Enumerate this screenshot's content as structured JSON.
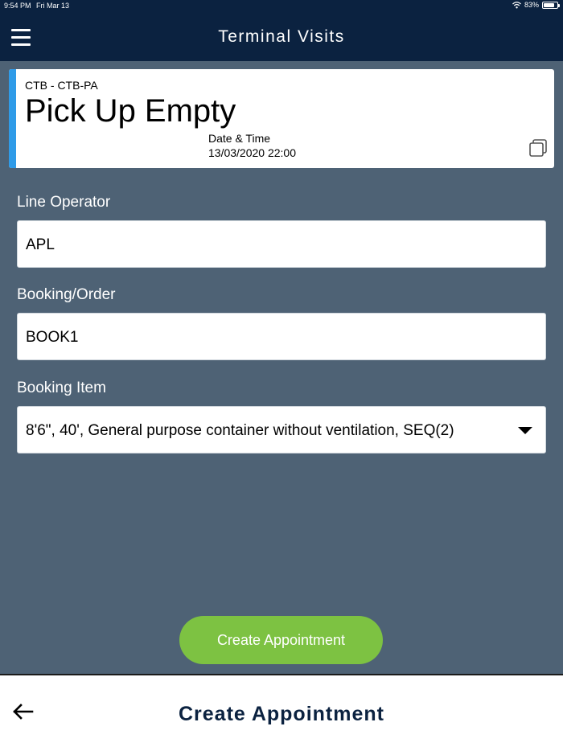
{
  "status_bar": {
    "time": "9:54 PM",
    "date": "Fri Mar 13",
    "battery": "83%",
    "battery_level": 0.83
  },
  "header": {
    "title": "Terminal Visits"
  },
  "visit_card": {
    "code": "CTB - CTB-PA",
    "type": "Pick Up Empty",
    "datetime_label": "Date & Time",
    "datetime_value": "13/03/2020 22:00"
  },
  "form": {
    "line_operator": {
      "label": "Line Operator",
      "value": "APL"
    },
    "booking_order": {
      "label": "Booking/Order",
      "value": "BOOK1"
    },
    "booking_item": {
      "label": "Booking Item",
      "value": "8'6\", 40', General purpose container without ventilation, SEQ(2)"
    }
  },
  "actions": {
    "create_button": "Create Appointment"
  },
  "footer": {
    "title": "Create Appointment"
  },
  "colors": {
    "nav": "#0b2240",
    "background": "#4e6275",
    "accent": "#2f9be8",
    "button": "#7dc242"
  },
  "icons": {
    "menu": "hamburger-icon",
    "wifi": "wifi-icon",
    "battery": "battery-icon",
    "copy": "copy-icon",
    "back": "back-arrow-icon",
    "dropdown": "chevron-down-icon"
  }
}
